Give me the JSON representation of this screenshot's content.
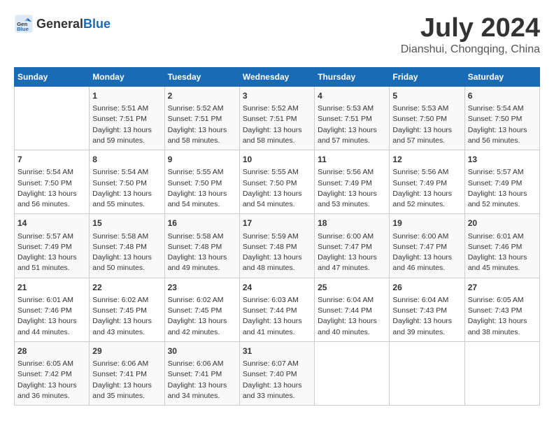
{
  "header": {
    "logo_general": "General",
    "logo_blue": "Blue",
    "title": "July 2024",
    "subtitle": "Dianshui, Chongqing, China"
  },
  "calendar": {
    "days_of_week": [
      "Sunday",
      "Monday",
      "Tuesday",
      "Wednesday",
      "Thursday",
      "Friday",
      "Saturday"
    ],
    "weeks": [
      [
        {
          "day": "",
          "info": ""
        },
        {
          "day": "1",
          "info": "Sunrise: 5:51 AM\nSunset: 7:51 PM\nDaylight: 13 hours\nand 59 minutes."
        },
        {
          "day": "2",
          "info": "Sunrise: 5:52 AM\nSunset: 7:51 PM\nDaylight: 13 hours\nand 58 minutes."
        },
        {
          "day": "3",
          "info": "Sunrise: 5:52 AM\nSunset: 7:51 PM\nDaylight: 13 hours\nand 58 minutes."
        },
        {
          "day": "4",
          "info": "Sunrise: 5:53 AM\nSunset: 7:51 PM\nDaylight: 13 hours\nand 57 minutes."
        },
        {
          "day": "5",
          "info": "Sunrise: 5:53 AM\nSunset: 7:50 PM\nDaylight: 13 hours\nand 57 minutes."
        },
        {
          "day": "6",
          "info": "Sunrise: 5:54 AM\nSunset: 7:50 PM\nDaylight: 13 hours\nand 56 minutes."
        }
      ],
      [
        {
          "day": "7",
          "info": "Sunrise: 5:54 AM\nSunset: 7:50 PM\nDaylight: 13 hours\nand 56 minutes."
        },
        {
          "day": "8",
          "info": "Sunrise: 5:54 AM\nSunset: 7:50 PM\nDaylight: 13 hours\nand 55 minutes."
        },
        {
          "day": "9",
          "info": "Sunrise: 5:55 AM\nSunset: 7:50 PM\nDaylight: 13 hours\nand 54 minutes."
        },
        {
          "day": "10",
          "info": "Sunrise: 5:55 AM\nSunset: 7:50 PM\nDaylight: 13 hours\nand 54 minutes."
        },
        {
          "day": "11",
          "info": "Sunrise: 5:56 AM\nSunset: 7:49 PM\nDaylight: 13 hours\nand 53 minutes."
        },
        {
          "day": "12",
          "info": "Sunrise: 5:56 AM\nSunset: 7:49 PM\nDaylight: 13 hours\nand 52 minutes."
        },
        {
          "day": "13",
          "info": "Sunrise: 5:57 AM\nSunset: 7:49 PM\nDaylight: 13 hours\nand 52 minutes."
        }
      ],
      [
        {
          "day": "14",
          "info": "Sunrise: 5:57 AM\nSunset: 7:49 PM\nDaylight: 13 hours\nand 51 minutes."
        },
        {
          "day": "15",
          "info": "Sunrise: 5:58 AM\nSunset: 7:48 PM\nDaylight: 13 hours\nand 50 minutes."
        },
        {
          "day": "16",
          "info": "Sunrise: 5:58 AM\nSunset: 7:48 PM\nDaylight: 13 hours\nand 49 minutes."
        },
        {
          "day": "17",
          "info": "Sunrise: 5:59 AM\nSunset: 7:48 PM\nDaylight: 13 hours\nand 48 minutes."
        },
        {
          "day": "18",
          "info": "Sunrise: 6:00 AM\nSunset: 7:47 PM\nDaylight: 13 hours\nand 47 minutes."
        },
        {
          "day": "19",
          "info": "Sunrise: 6:00 AM\nSunset: 7:47 PM\nDaylight: 13 hours\nand 46 minutes."
        },
        {
          "day": "20",
          "info": "Sunrise: 6:01 AM\nSunset: 7:46 PM\nDaylight: 13 hours\nand 45 minutes."
        }
      ],
      [
        {
          "day": "21",
          "info": "Sunrise: 6:01 AM\nSunset: 7:46 PM\nDaylight: 13 hours\nand 44 minutes."
        },
        {
          "day": "22",
          "info": "Sunrise: 6:02 AM\nSunset: 7:45 PM\nDaylight: 13 hours\nand 43 minutes."
        },
        {
          "day": "23",
          "info": "Sunrise: 6:02 AM\nSunset: 7:45 PM\nDaylight: 13 hours\nand 42 minutes."
        },
        {
          "day": "24",
          "info": "Sunrise: 6:03 AM\nSunset: 7:44 PM\nDaylight: 13 hours\nand 41 minutes."
        },
        {
          "day": "25",
          "info": "Sunrise: 6:04 AM\nSunset: 7:44 PM\nDaylight: 13 hours\nand 40 minutes."
        },
        {
          "day": "26",
          "info": "Sunrise: 6:04 AM\nSunset: 7:43 PM\nDaylight: 13 hours\nand 39 minutes."
        },
        {
          "day": "27",
          "info": "Sunrise: 6:05 AM\nSunset: 7:43 PM\nDaylight: 13 hours\nand 38 minutes."
        }
      ],
      [
        {
          "day": "28",
          "info": "Sunrise: 6:05 AM\nSunset: 7:42 PM\nDaylight: 13 hours\nand 36 minutes."
        },
        {
          "day": "29",
          "info": "Sunrise: 6:06 AM\nSunset: 7:41 PM\nDaylight: 13 hours\nand 35 minutes."
        },
        {
          "day": "30",
          "info": "Sunrise: 6:06 AM\nSunset: 7:41 PM\nDaylight: 13 hours\nand 34 minutes."
        },
        {
          "day": "31",
          "info": "Sunrise: 6:07 AM\nSunset: 7:40 PM\nDaylight: 13 hours\nand 33 minutes."
        },
        {
          "day": "",
          "info": ""
        },
        {
          "day": "",
          "info": ""
        },
        {
          "day": "",
          "info": ""
        }
      ]
    ]
  }
}
